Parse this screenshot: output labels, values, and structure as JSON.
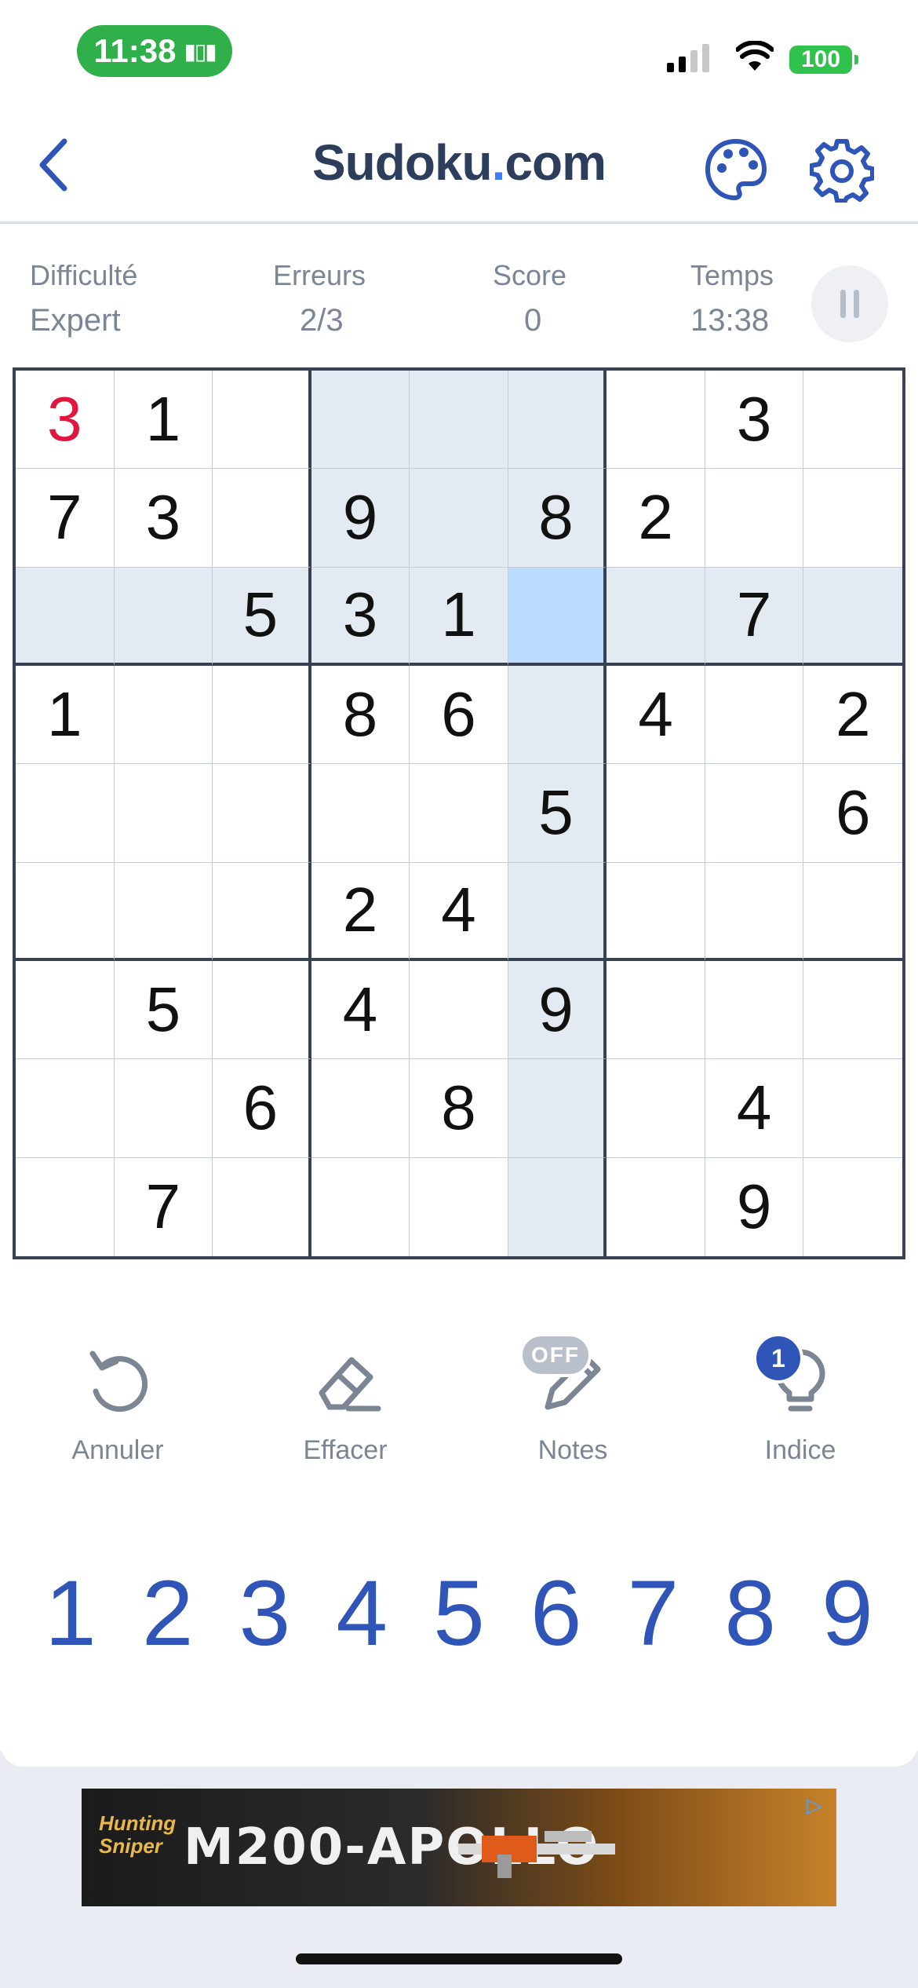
{
  "status_bar": {
    "time": "11:38",
    "battery": "100"
  },
  "header": {
    "title_main": "Sudoku",
    "title_dot": ".",
    "title_tld": "com",
    "back_icon": "chevron-left-icon",
    "palette_icon": "palette-icon",
    "settings_icon": "gear-icon"
  },
  "info": {
    "difficulty_label": "Difficulté",
    "difficulty_value": "Expert",
    "errors_label": "Erreurs",
    "errors_value": "2/3",
    "score_label": "Score",
    "score_value": "0",
    "time_label": "Temps",
    "time_value": "13:38"
  },
  "board": {
    "rows": [
      [
        "3",
        "1",
        "",
        "",
        "",
        "",
        "",
        "3",
        ""
      ],
      [
        "7",
        "3",
        "",
        "9",
        "",
        "8",
        "2",
        "",
        ""
      ],
      [
        "",
        "",
        "5",
        "3",
        "1",
        "",
        "",
        "7",
        ""
      ],
      [
        "1",
        "",
        "",
        "8",
        "6",
        "",
        "4",
        "",
        "2"
      ],
      [
        "",
        "",
        "",
        "",
        "",
        "5",
        "",
        "",
        "6"
      ],
      [
        "",
        "",
        "",
        "2",
        "4",
        "",
        "",
        "",
        ""
      ],
      [
        "",
        "5",
        "",
        "4",
        "",
        "9",
        "",
        "",
        ""
      ],
      [
        "",
        "",
        "6",
        "",
        "8",
        "",
        "",
        "4",
        ""
      ],
      [
        "",
        "7",
        "",
        "",
        "",
        "",
        "",
        "9",
        ""
      ]
    ],
    "selected_cell": [
      2,
      5
    ],
    "error_cells": [
      [
        0,
        0
      ]
    ],
    "colors": {
      "highlight": "#e3eaf2",
      "selected": "#b9dcff",
      "error": "#e0163e"
    }
  },
  "tools": {
    "undo_label": "Annuler",
    "erase_label": "Effacer",
    "notes_label": "Notes",
    "notes_state": "OFF",
    "hint_label": "Indice",
    "hint_count": "1"
  },
  "numpad": [
    "1",
    "2",
    "3",
    "4",
    "5",
    "6",
    "7",
    "8",
    "9"
  ],
  "ad": {
    "brand_line1": "Hunting",
    "brand_line2": "Sniper",
    "title": "M200-APOLLO"
  },
  "accent_color": "#2f55b8"
}
